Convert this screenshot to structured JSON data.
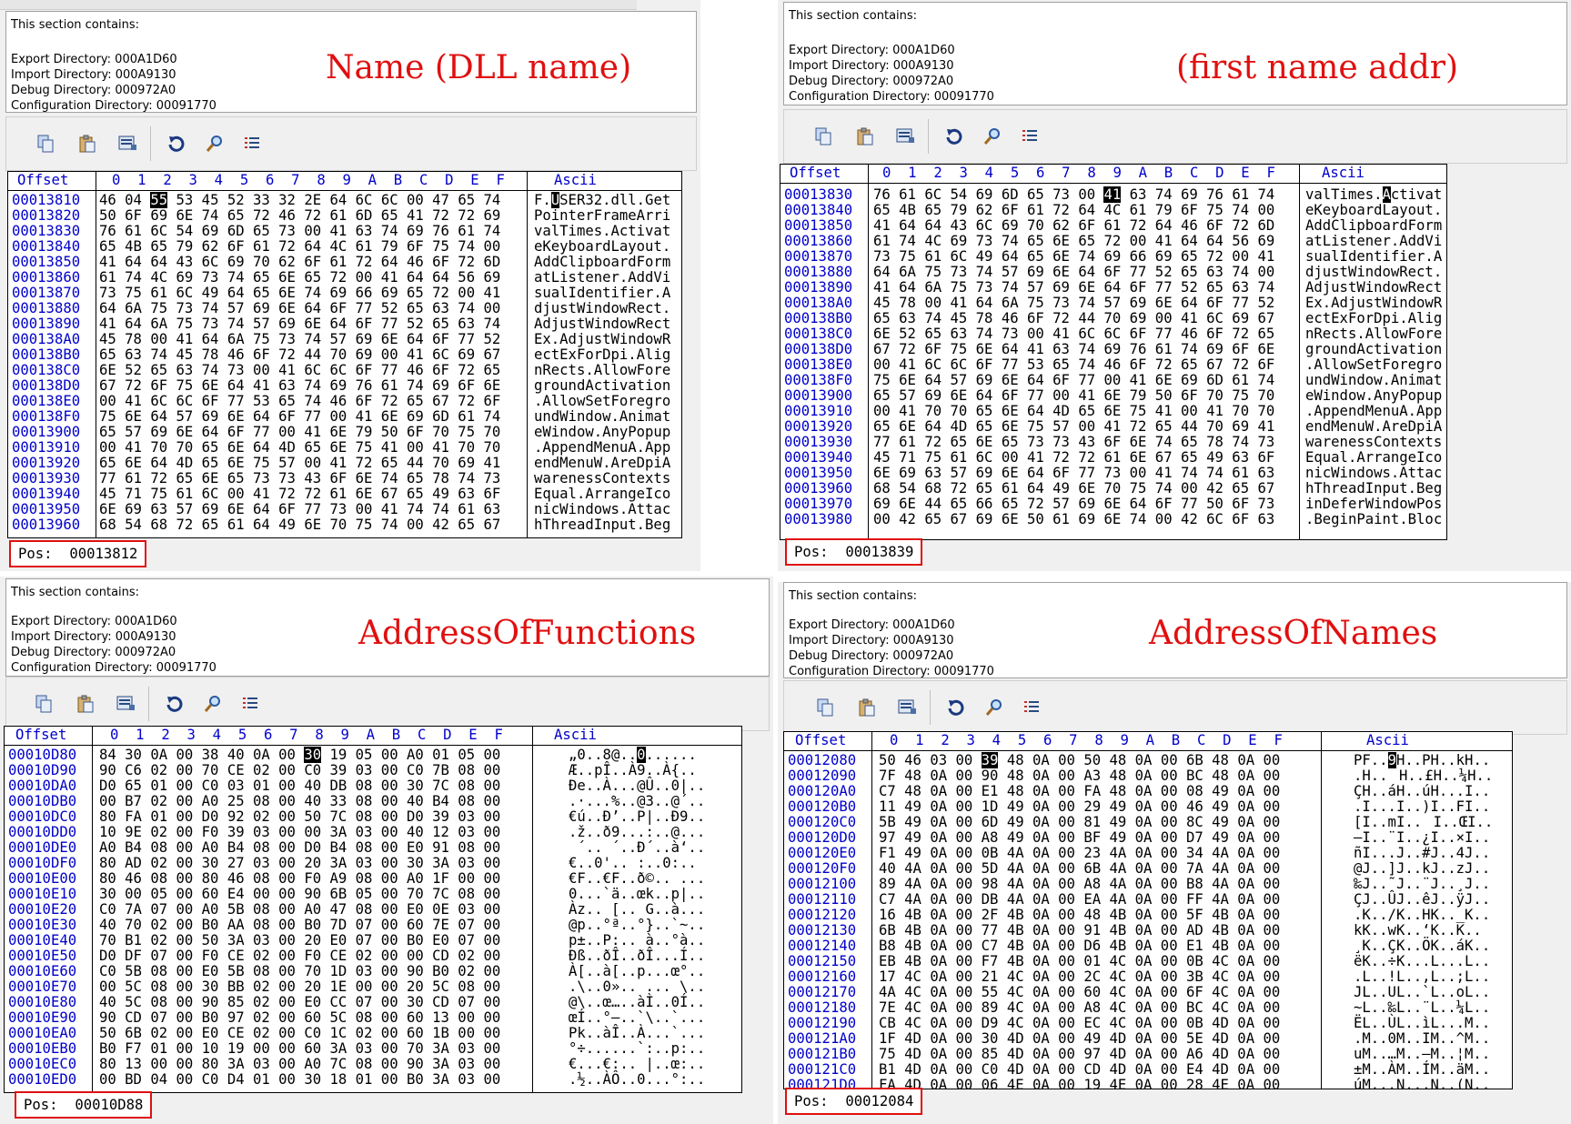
{
  "panels": [
    {
      "id": "name",
      "caption": "Name (DLL name)",
      "section_heading": "This section contains:",
      "section_lines": [
        "Export Directory: 000A1D60",
        "Import Directory: 000A9130",
        "Debug Directory: 000972A0",
        "Configuration Directory: 00091770"
      ],
      "header_offset": "Offset",
      "header_cols": "0  1  2  3  4  5  6  7  8  9  A  B  C  D  E  F",
      "header_ascii": "Ascii",
      "offsets": "00013810\n00013820\n00013830\n00013840\n00013850\n00013860\n00013870\n00013880\n00013890\n000138A0\n000138B0\n000138C0\n000138D0\n000138E0\n000138F0\n00013900\n00013910\n00013920\n00013930\n00013940\n00013950\n00013960",
      "hex_pre": "46 04 ",
      "hex_cursor": "55",
      "hex_post": " 53 45 52 33 32 2E 64 6C 6C 00 47 65 74\n50 6F 69 6E 74 65 72 46 72 61 6D 65 41 72 72 69\n76 61 6C 54 69 6D 65 73 00 41 63 74 69 76 61 74\n65 4B 65 79 62 6F 61 72 64 4C 61 79 6F 75 74 00\n41 64 64 43 6C 69 70 62 6F 61 72 64 46 6F 72 6D\n61 74 4C 69 73 74 65 6E 65 72 00 41 64 64 56 69\n73 75 61 6C 49 64 65 6E 74 69 66 69 65 72 00 41\n64 6A 75 73 74 57 69 6E 64 6F 77 52 65 63 74 00\n41 64 6A 75 73 74 57 69 6E 64 6F 77 52 65 63 74\n45 78 00 41 64 6A 75 73 74 57 69 6E 64 6F 77 52\n65 63 74 45 78 46 6F 72 44 70 69 00 41 6C 69 67\n6E 52 65 63 74 73 00 41 6C 6C 6F 77 46 6F 72 65\n67 72 6F 75 6E 64 41 63 74 69 76 61 74 69 6F 6E\n00 41 6C 6C 6F 77 53 65 74 46 6F 72 65 67 72 6F\n75 6E 64 57 69 6E 64 6F 77 00 41 6E 69 6D 61 74\n65 57 69 6E 64 6F 77 00 41 6E 79 50 6F 70 75 70\n00 41 70 70 65 6E 64 4D 65 6E 75 41 00 41 70 70\n65 6E 64 4D 65 6E 75 57 00 41 72 65 44 70 69 41\n77 61 72 65 6E 65 73 73 43 6F 6E 74 65 78 74 73\n45 71 75 61 6C 00 41 72 72 61 6E 67 65 49 63 6F\n6E 69 63 57 69 6E 64 6F 77 73 00 41 74 74 61 63\n68 54 68 72 65 61 64 49 6E 70 75 74 00 42 65 67",
      "ascii_pre": "F.",
      "ascii_cursor": "U",
      "ascii_post": "SER32.dll.Get\nPointerFrameArri\nvalTimes.Activat\neKeyboardLayout.\nAddClipboardForm\natListener.AddVi\nsualIdentifier.A\ndjustWindowRect.\nAdjustWindowRect\nEx.AdjustWindowR\nectExForDpi.Alig\nnRects.AllowFore\ngroundActivation\n.AllowSetForegro\nundWindow.Animat\neWindow.AnyPopup\n.AppendMenuA.App\nendMenuW.AreDpiA\nwarenessContexts\nEqual.ArrangeIco\nnicWindows.Attac\nhThreadInput.Beg",
      "pos_label": "Pos:",
      "pos_value": "00013812"
    },
    {
      "id": "first-name-addr",
      "caption": "(first name addr)",
      "section_heading": "This section contains:",
      "section_lines": [
        "Export Directory: 000A1D60",
        "Import Directory: 000A9130",
        "Debug Directory: 000972A0",
        "Configuration Directory: 00091770"
      ],
      "header_offset": "Offset",
      "header_cols": "0  1  2  3  4  5  6  7  8  9  A  B  C  D  E  F",
      "header_ascii": "Ascii",
      "offsets": "00013830\n00013840\n00013850\n00013860\n00013870\n00013880\n00013890\n000138A0\n000138B0\n000138C0\n000138D0\n000138E0\n000138F0\n00013900\n00013910\n00013920\n00013930\n00013940\n00013950\n00013960\n00013970\n00013980",
      "hex_pre": "76 61 6C 54 69 6D 65 73 00 ",
      "hex_cursor": "41",
      "hex_post": " 63 74 69 76 61 74\n65 4B 65 79 62 6F 61 72 64 4C 61 79 6F 75 74 00\n41 64 64 43 6C 69 70 62 6F 61 72 64 46 6F 72 6D\n61 74 4C 69 73 74 65 6E 65 72 00 41 64 64 56 69\n73 75 61 6C 49 64 65 6E 74 69 66 69 65 72 00 41\n64 6A 75 73 74 57 69 6E 64 6F 77 52 65 63 74 00\n41 64 6A 75 73 74 57 69 6E 64 6F 77 52 65 63 74\n45 78 00 41 64 6A 75 73 74 57 69 6E 64 6F 77 52\n65 63 74 45 78 46 6F 72 44 70 69 00 41 6C 69 67\n6E 52 65 63 74 73 00 41 6C 6C 6F 77 46 6F 72 65\n67 72 6F 75 6E 64 41 63 74 69 76 61 74 69 6F 6E\n00 41 6C 6C 6F 77 53 65 74 46 6F 72 65 67 72 6F\n75 6E 64 57 69 6E 64 6F 77 00 41 6E 69 6D 61 74\n65 57 69 6E 64 6F 77 00 41 6E 79 50 6F 70 75 70\n00 41 70 70 65 6E 64 4D 65 6E 75 41 00 41 70 70\n65 6E 64 4D 65 6E 75 57 00 41 72 65 44 70 69 41\n77 61 72 65 6E 65 73 73 43 6F 6E 74 65 78 74 73\n45 71 75 61 6C 00 41 72 72 61 6E 67 65 49 63 6F\n6E 69 63 57 69 6E 64 6F 77 73 00 41 74 74 61 63\n68 54 68 72 65 61 64 49 6E 70 75 74 00 42 65 67\n69 6E 44 65 66 65 72 57 69 6E 64 6F 77 50 6F 73\n00 42 65 67 69 6E 50 61 69 6E 74 00 42 6C 6F 63",
      "ascii_pre": "valTimes.",
      "ascii_cursor": "A",
      "ascii_post": "ctivat\neKeyboardLayout.\nAddClipboardForm\natListener.AddVi\nsualIdentifier.A\ndjustWindowRect.\nAdjustWindowRect\nEx.AdjustWindowR\nectExForDpi.Alig\nnRects.AllowFore\ngroundActivation\n.AllowSetForegro\nundWindow.Animat\neWindow.AnyPopup\n.AppendMenuA.App\nendMenuW.AreDpiA\nwarenessContexts\nEqual.ArrangeIco\nnicWindows.Attac\nhThreadInput.Beg\ninDeferWindowPos\n.BeginPaint.Bloc",
      "pos_label": "Pos:",
      "pos_value": "00013839"
    },
    {
      "id": "address-of-functions",
      "caption": "AddressOfFunctions",
      "section_heading": "This section contains:",
      "section_lines": [
        "Export Directory: 000A1D60",
        "Import Directory: 000A9130",
        "Debug Directory: 000972A0",
        "Configuration Directory: 00091770"
      ],
      "header_offset": "Offset",
      "header_cols": "0  1  2  3  4  5  6  7  8  9  A  B  C  D  E  F",
      "header_ascii": "Ascii",
      "offsets": "00010D80\n00010D90\n00010DA0\n00010DB0\n00010DC0\n00010DD0\n00010DE0\n00010DF0\n00010E00\n00010E10\n00010E20\n00010E30\n00010E40\n00010E50\n00010E60\n00010E70\n00010E80\n00010E90\n00010EA0\n00010EB0\n00010EC0\n00010ED0",
      "hex_pre": "84 30 0A 00 38 40 0A 00 ",
      "hex_cursor": "30",
      "hex_post": " 19 05 00 A0 01 05 00\n90 C6 02 00 70 CE 02 00 C0 39 03 00 C0 7B 08 00\nD0 65 01 00 C0 03 01 00 40 DB 08 00 30 7C 08 00\n00 B7 02 00 A0 25 08 00 40 33 08 00 40 B4 08 00\n80 FA 01 00 D0 92 02 00 50 7C 08 00 D0 39 03 00\n10 9E 02 00 F0 39 03 00 00 3A 03 00 40 12 03 00\nA0 B4 08 00 A0 B4 08 00 D0 B4 08 00 E0 91 08 00\n80 AD 02 00 30 27 03 00 20 3A 03 00 30 3A 03 00\n80 46 08 00 80 46 08 00 F0 A9 08 00 A0 1F 00 00\n30 00 05 00 60 E4 00 00 90 6B 05 00 70 7C 08 00\nC0 7A 07 00 A0 5B 08 00 A0 47 08 00 E0 0E 03 00\n40 70 02 00 B0 AA 08 00 B0 7D 07 00 60 7E 07 00\n70 B1 02 00 50 3A 03 00 20 E0 07 00 B0 E0 07 00\nD0 DF 07 00 F0 CE 02 00 F0 CE 02 00 00 CD 02 00\nC0 5B 08 00 E0 5B 08 00 70 1D 03 00 90 B0 02 00\n00 5C 08 00 30 BB 02 00 20 1E 00 00 20 5C 08 00\n40 5C 08 00 90 85 02 00 E0 CC 07 00 30 CD 07 00\n90 CD 07 00 B0 97 02 00 60 5C 08 00 60 13 00 00\n50 6B 02 00 E0 CE 02 00 C0 1C 02 00 60 1B 00 00\nB0 F7 01 00 10 19 00 00 60 3A 03 00 70 3A 03 00\n80 13 00 00 80 3A 03 00 A0 7C 08 00 90 3A 03 00\n00 BD 04 00 C0 D4 01 00 30 18 01 00 B0 3A 03 00",
      "ascii_pre": "„0..8@..",
      "ascii_cursor": "0",
      "ascii_post": "......\nÆ..pÎ..À9..À{..\nÐe..À...@Û..0|..\n.·...%..@3..@´..\n€ú..Ð’..P|..Ð9..\n.ž..ð9...:..@...\n ´.. ´..Ð´..à‘..\n€­..0'.. :..0:..\n€F..€F..ð©.. ...\n0...`ä..œk..p|..\nÀz.. [.. G..à...\n@p..°ª..°}..`~..\np±..P:.. à..°à..\nÐß..ðÎ..ðÎ...Í..\nÀ[..à[..p...œ°..\n.\\..0».. ... \\..\n@\\..œ…..àÌ..0Í..\nœÍ..°—..`\\..`...\nPk..àÎ..À...`...\n°÷......`:..p:..\n€...€:.. |..œ:..\n.½..ÀÔ..0...°:..",
      "pos_label": "Pos:",
      "pos_value": "00010D88"
    },
    {
      "id": "address-of-names",
      "caption": "AddressOfNames",
      "section_heading": "This section contains:",
      "section_lines": [
        "Export Directory: 000A1D60",
        "Import Directory: 000A9130",
        "Debug Directory: 000972A0",
        "Configuration Directory: 00091770"
      ],
      "header_offset": "Offset",
      "header_cols": "0  1  2  3  4  5  6  7  8  9  A  B  C  D  E  F",
      "header_ascii": "Ascii",
      "offsets": "00012080\n00012090\n000120A0\n000120B0\n000120C0\n000120D0\n000120E0\n000120F0\n00012100\n00012110\n00012120\n00012130\n00012140\n00012150\n00012160\n00012170\n00012180\n00012190\n000121A0\n000121B0\n000121C0\n000121D0",
      "hex_pre": "50 46 03 00 ",
      "hex_cursor": "39",
      "hex_post": " 48 0A 00 50 48 0A 00 6B 48 0A 00\n7F 48 0A 00 90 48 0A 00 A3 48 0A 00 BC 48 0A 00\nC7 48 0A 00 E1 48 0A 00 FA 48 0A 00 08 49 0A 00\n11 49 0A 00 1D 49 0A 00 29 49 0A 00 46 49 0A 00\n5B 49 0A 00 6D 49 0A 00 81 49 0A 00 8C 49 0A 00\n97 49 0A 00 A8 49 0A 00 BF 49 0A 00 D7 49 0A 00\nF1 49 0A 00 0B 4A 0A 00 23 4A 0A 00 34 4A 0A 00\n40 4A 0A 00 5D 4A 0A 00 6B 4A 0A 00 7A 4A 0A 00\n89 4A 0A 00 98 4A 0A 00 A8 4A 0A 00 B8 4A 0A 00\nC7 4A 0A 00 DB 4A 0A 00 EA 4A 0A 00 FF 4A 0A 00\n16 4B 0A 00 2F 4B 0A 00 48 4B 0A 00 5F 4B 0A 00\n6B 4B 0A 00 77 4B 0A 00 91 4B 0A 00 AD 4B 0A 00\nB8 4B 0A 00 C7 4B 0A 00 D6 4B 0A 00 E1 4B 0A 00\nEB 4B 0A 00 F7 4B 0A 00 01 4C 0A 00 0B 4C 0A 00\n17 4C 0A 00 21 4C 0A 00 2C 4C 0A 00 3B 4C 0A 00\n4A 4C 0A 00 55 4C 0A 00 60 4C 0A 00 6F 4C 0A 00\n7E 4C 0A 00 89 4C 0A 00 A8 4C 0A 00 BC 4C 0A 00\nCB 4C 0A 00 D9 4C 0A 00 EC 4C 0A 00 0B 4D 0A 00\n1F 4D 0A 00 30 4D 0A 00 49 4D 0A 00 5E 4D 0A 00\n75 4D 0A 00 85 4D 0A 00 97 4D 0A 00 A6 4D 0A 00\nB1 4D 0A 00 C0 4D 0A 00 CD 4D 0A 00 E4 4D 0A 00\nFA 4D 0A 00 06 4E 0A 00 19 4E 0A 00 28 4E 0A 00",
      "ascii_pre": "PF..",
      "ascii_cursor": "9",
      "ascii_post": "H..PH..kH..\n.H..H..£H..¼H..\nÇH..áH..úH...I..\n.I...I..)I..FI..\n[I..mI..I..ŒI..\n—I..¨I..¿I..×I..\nñI...J..#J..4J..\n@J..]J..kJ..zJ..\n‰J..˜J..¨J..¸J..\nÇJ..ÛJ..êJ..ÿJ..\n.K../K..HK.._K..\nkK..wK..‘K..­K..\n¸K..ÇK..ÖK..áK..\nëK..÷K...L...L..\n.L..!L..,L..;L..\nJL..UL..`L..oL..\n~L..‰L..¨L..¼L..\nËL..ÙL..ìL...M..\n.M..0M..IM..^M..\nuM..…M..—M..¦M..\n±M..ÀM..ÍM..äM..\núM...N...N..(N..",
      "pos_label": "Pos:",
      "pos_value": "00012084"
    }
  ],
  "toolbar_icons": [
    "copy-icon",
    "paste-icon",
    "disassemble-icon",
    "refresh-icon",
    "search-icon",
    "list-icon"
  ],
  "colors": {
    "caption": "#e01010",
    "offset_text": "#0000cc",
    "pos_border": "#e01010"
  }
}
